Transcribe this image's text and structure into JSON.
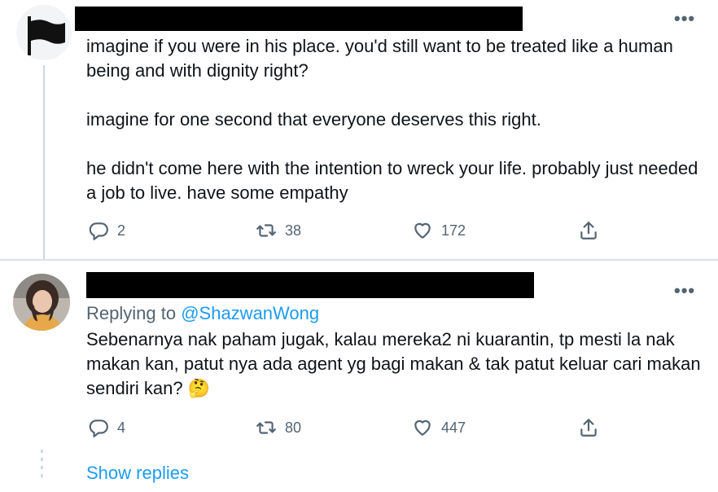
{
  "tweet1": {
    "paragraphs": [
      "imagine if you were in his place. you'd still want to be treated like a human being and with dignity right?",
      "imagine for one second that everyone deserves this right.",
      "he didn't come here with the intention to wreck your life. probably just needed a job to live. have some empathy"
    ],
    "reply_count": "2",
    "retweet_count": "38",
    "like_count": "172",
    "more_label": "•••"
  },
  "tweet2": {
    "replying_prefix": "Replying to",
    "replying_handle": "@ShazwanWong",
    "text": "Sebenarnya nak paham jugak, kalau mereka2 ni kuarantin, tp mesti la nak makan kan, patut nya ada agent yg bagi makan & tak patut keluar cari makan sendiri kan?",
    "emoji": "🤔",
    "reply_count": "4",
    "retweet_count": "80",
    "like_count": "447",
    "more_label": "•••"
  },
  "show_replies_label": "Show replies",
  "colors": {
    "accent": "#1d9bf0",
    "muted": "#536471",
    "text": "#0f1419",
    "thread_line": "#cfd9de"
  },
  "icons": [
    "flag-icon",
    "reply-icon",
    "retweet-icon",
    "like-icon",
    "share-icon",
    "more-icon"
  ]
}
